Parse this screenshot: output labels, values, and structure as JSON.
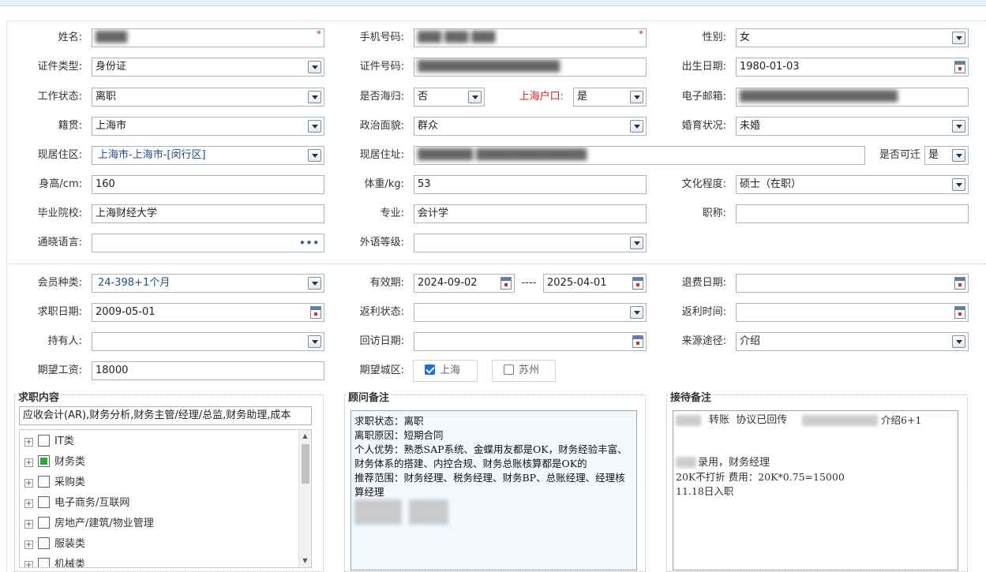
{
  "personal": {
    "name": {
      "label": "姓名:",
      "value": "████"
    },
    "mobile": {
      "label": "手机号码:",
      "value": "███ ███ ███"
    },
    "gender": {
      "label": "性别:",
      "value": "女"
    },
    "id_type": {
      "label": "证件类型:",
      "value": "身份证"
    },
    "id_number": {
      "label": "证件号码:",
      "value": "██████████████████"
    },
    "birth_date": {
      "label": "出生日期:",
      "value": "1980-01-03"
    },
    "work_status": {
      "label": "工作状态:",
      "value": "离职"
    },
    "returnee": {
      "label": "是否海归:",
      "value": "否"
    },
    "shanghai_hukou": {
      "label": "上海户口:",
      "value": "是"
    },
    "email": {
      "label": "电子邮箱:",
      "value": "████████████████████"
    },
    "native_place": {
      "label": "籍贯:",
      "value": "上海市"
    },
    "political_status": {
      "label": "政治面貌:",
      "value": "群众"
    },
    "marital_status": {
      "label": "婚育状况:",
      "value": "未婚"
    },
    "residence_area": {
      "label": "现居住区:",
      "value": "上海市-上海市-[闵行区]"
    },
    "residence_address": {
      "label": "现居住址:",
      "value": "███████ ██████████████"
    },
    "can_relocate": {
      "label": "是否可迁",
      "value": "是"
    },
    "height": {
      "label": "身高/cm:",
      "value": "160"
    },
    "weight": {
      "label": "体重/kg:",
      "value": "53"
    },
    "education": {
      "label": "文化程度:",
      "value": "硕士（在职）"
    },
    "school": {
      "label": "毕业院校:",
      "value": "上海财经大学"
    },
    "major": {
      "label": "专业:",
      "value": "会计学"
    },
    "title": {
      "label": "职称:",
      "value": ""
    },
    "languages": {
      "label": "通晓语言:",
      "value": ""
    },
    "foreign_level": {
      "label": "外语等级:",
      "value": ""
    }
  },
  "membership": {
    "member_type": {
      "label": "会员种类:",
      "value": "24-398+1个月"
    },
    "validity": {
      "label": "有效期:",
      "start": "2024-09-02",
      "separator": "----",
      "end": "2025-04-01"
    },
    "refund_date": {
      "label": "退费日期:",
      "value": ""
    },
    "job_seek_date": {
      "label": "求职日期:",
      "value": "2009-05-01"
    },
    "rebate_status": {
      "label": "返利状态:",
      "value": ""
    },
    "rebate_time": {
      "label": "返利时间:",
      "value": ""
    },
    "holder": {
      "label": "持有人:",
      "value": ""
    },
    "visit_date": {
      "label": "回访日期:",
      "value": ""
    },
    "source": {
      "label": "来源途径:",
      "value": "介绍"
    },
    "expected_salary": {
      "label": "期望工资:",
      "value": "18000"
    },
    "expected_city": {
      "label": "期望城区:",
      "options": [
        {
          "label": "上海",
          "checked": true
        },
        {
          "label": "苏州",
          "checked": false
        }
      ]
    }
  },
  "job_content": {
    "title": "求职内容",
    "selected_text": "应收会计(AR),财务分析,财务主管/经理/总监,财务助理,成本",
    "categories": [
      {
        "label": "IT类",
        "state": "unchecked"
      },
      {
        "label": "财务类",
        "state": "partial"
      },
      {
        "label": "采购类",
        "state": "unchecked"
      },
      {
        "label": "电子商务/互联网",
        "state": "unchecked"
      },
      {
        "label": "房地产/建筑/物业管理",
        "state": "unchecked"
      },
      {
        "label": "服装类",
        "state": "unchecked"
      },
      {
        "label": "机械类",
        "state": "unchecked"
      }
    ]
  },
  "consultant_notes": {
    "title": "顾问备注",
    "text": "求职状态：离职\n离职原因：短期合同\n个人优势：熟悉SAP系统、金蝶用友都是OK，财务经验丰富、财务体系的搭建、内控合规、财务总账核算都是OK的\n推荐范围：财务经理、税务经理、财务BP、总账经理、经理核算经理"
  },
  "reception_notes": {
    "title": "接待备注",
    "line1_mid": "转账  协议已回传",
    "line1_end": "介绍6+1",
    "line2": "录用，财务经理",
    "line3": "20K不打折 费用：20K*0.75=15000",
    "line4": "11.18日入职"
  },
  "colors": {
    "field_border": "#aab5c2",
    "accent_red": "#e02020",
    "checkbox_blue": "#1a6fe0",
    "tree_check_green": "#2aa63a"
  }
}
